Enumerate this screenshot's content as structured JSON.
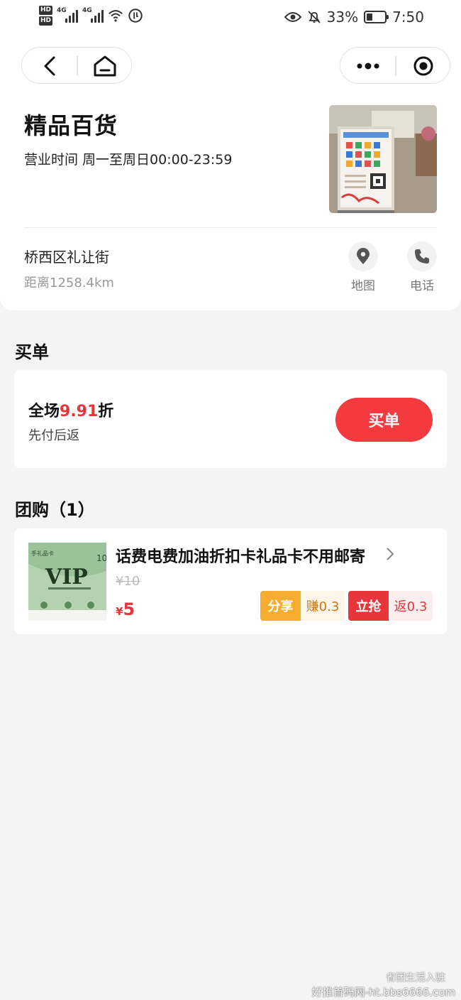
{
  "status_bar": {
    "hd1": "HD",
    "hd2": "HD",
    "net1": "4G",
    "net2": "4G",
    "battery_percent_text": "33%",
    "battery_level": 0.33,
    "time": "7:50"
  },
  "store": {
    "name": "精品百货",
    "hours": "营业时间 周一至周日00:00-23:59",
    "address": "桥西区礼让街",
    "distance": "距离1258.4km",
    "map_label": "地图",
    "phone_label": "电话"
  },
  "pay_section": {
    "title": "买单",
    "offer_prefix": "全场",
    "offer_value": "9.91",
    "offer_suffix": "折",
    "offer_sub": "先付后返",
    "button_label": "买单"
  },
  "group_section": {
    "title": "团购（1）",
    "deal": {
      "title": "话费电费加油折扣卡礼品卡不用邮寄",
      "old_price": "¥10",
      "currency": "¥",
      "price": "5",
      "share_label": "分享",
      "earn_label": "赚0.3",
      "grab_label": "立抢",
      "return_label": "返0.3",
      "image": {
        "corner_text": "手礼品卡",
        "value_text": "10",
        "vip_text": "VIP"
      }
    }
  },
  "watermark": {
    "line1": "省团生活入驻",
    "line2": "好推首码网-ht.bbs6666.com"
  },
  "colors": {
    "accent_red": "#f33a3f",
    "share_orange": "#f6ac2e",
    "background": "#f4f4f4"
  }
}
